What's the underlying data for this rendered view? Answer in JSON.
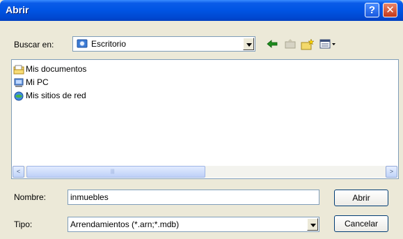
{
  "window": {
    "title": "Abrir",
    "help_glyph": "?",
    "close_glyph": "✕"
  },
  "lookin": {
    "label": "Buscar en:",
    "value": "Escritorio"
  },
  "files": [
    {
      "name": "Mis documentos",
      "icon": "folder-documents-icon"
    },
    {
      "name": "Mi PC",
      "icon": "computer-icon"
    },
    {
      "name": "Mis sitios de red",
      "icon": "network-places-icon"
    }
  ],
  "filename": {
    "label": "Nombre:",
    "value": "inmuebles"
  },
  "filetype": {
    "label": "Tipo:",
    "value": "Arrendamientos (*.arn;*.mdb)"
  },
  "buttons": {
    "open": "Abrir",
    "cancel": "Cancelar"
  },
  "scroll": {
    "left": "<",
    "right": ">",
    "grip": "|||"
  }
}
